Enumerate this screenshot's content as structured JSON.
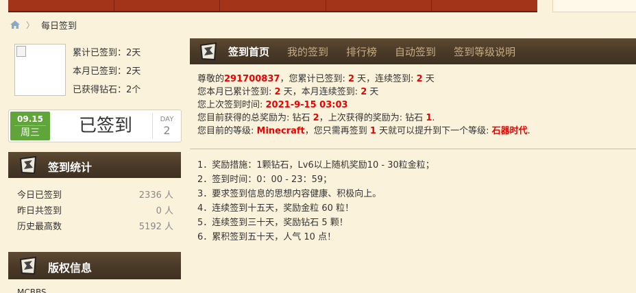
{
  "breadcrumb": {
    "current": "每日签到"
  },
  "user": {
    "stats": [
      {
        "label": "累计已签到：",
        "value": "2天"
      },
      {
        "label": "本月已签到：",
        "value": "2天"
      },
      {
        "label": "已获得钻石：",
        "value": "2个"
      }
    ]
  },
  "checkin": {
    "date": "09.15",
    "weekday": "周三",
    "status": "已签到",
    "day_label": "DAY",
    "day_count": "2"
  },
  "stats_panel": {
    "title": "签到统计",
    "rows": [
      {
        "label": "今日已签到",
        "value": "2336 人"
      },
      {
        "label": "昨日共签到",
        "value": "0 人"
      },
      {
        "label": "历史最高数",
        "value": "5192 人"
      }
    ]
  },
  "copyright_panel": {
    "title": "版权信息"
  },
  "tabs": [
    "签到首页",
    "我的签到",
    "排行榜",
    "自动签到",
    "签到等级说明"
  ],
  "info": {
    "line1": {
      "p1": "尊敬的",
      "uid": "291700837",
      "p2": "，您累计已签到: ",
      "total": "2",
      "p3": " 天，连续签到: ",
      "cont": "2",
      "p4": " 天"
    },
    "line2": {
      "p1": "您本月已累计签到: ",
      "month": "2",
      "p2": " 天，本月连续签到: ",
      "mcont": "2",
      "p3": " 天"
    },
    "line3": {
      "p1": "您上次签到时间: ",
      "time": "2021-9-15 03:03"
    },
    "line4": {
      "p1": "您目前获得的总奖励为: 钻石 ",
      "total_reward": "2",
      "p2": "，上次获得的奖励为: 钻石 ",
      "last_reward": "1",
      "p3": "."
    },
    "line5": {
      "p1": "您目前的等级: ",
      "level": "Minecraft",
      "p2": "，您只需再签到 ",
      "need": "1",
      "p3": " 天就可以提升到下一个等级: ",
      "next": "石器时代",
      "p4": "."
    }
  },
  "rules": [
    "1．奖励措施：1颗钻石，Lv6以上随机奖励10 - 30粒金粒；",
    "2．签到时间：0：00 - 23：59；",
    "3．要求签到信息的思想内容健康、积极向上。",
    "4．连续签到十五天，奖励金粒 60 粒！",
    "5．连续签到三十天，奖励钻石 5 颗！",
    "6．累积签到五十天，人气 10 点！"
  ],
  "tail": "MCBBS"
}
